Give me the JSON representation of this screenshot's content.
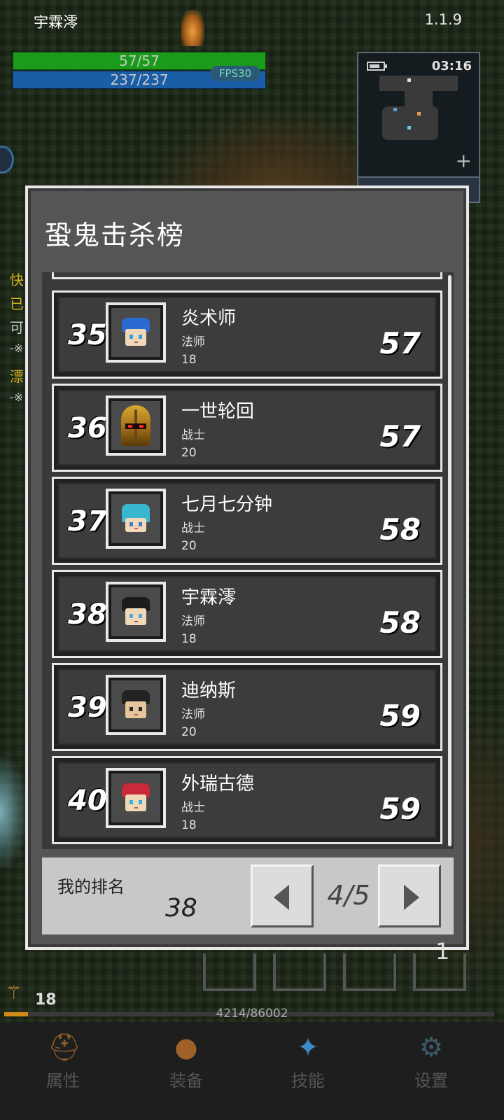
{
  "hud": {
    "player_name": "宇霖澪",
    "version": "1.1.9",
    "hp_text": "57/57",
    "mp_text": "237/237",
    "fps": "FPS30",
    "clock": "03:16",
    "side_lines": [
      "快",
      "已",
      "可",
      "-※",
      "漂",
      "-※"
    ]
  },
  "dialog": {
    "title": "蛩鬼击杀榜",
    "rows": [
      {
        "rank": "35",
        "name": "炎术师",
        "class": "法师",
        "level": "18",
        "kills": "57",
        "avatar": "blue-hair-mage-icon"
      },
      {
        "rank": "36",
        "name": "一世轮回",
        "class": "战士",
        "level": "20",
        "kills": "57",
        "avatar": "gold-helmet-warrior-icon"
      },
      {
        "rank": "37",
        "name": "七月七分钟",
        "class": "战士",
        "level": "20",
        "kills": "58",
        "avatar": "cyan-hair-warrior-icon"
      },
      {
        "rank": "38",
        "name": "宇霖澪",
        "class": "法师",
        "level": "18",
        "kills": "58",
        "avatar": "black-hair-mage-icon"
      },
      {
        "rank": "39",
        "name": "迪纳斯",
        "class": "法师",
        "level": "20",
        "kills": "59",
        "avatar": "black-hair-mage-icon"
      },
      {
        "rank": "40",
        "name": "外瑞古德",
        "class": "战士",
        "level": "18",
        "kills": "59",
        "avatar": "red-hair-warrior-icon"
      }
    ],
    "my_rank_label": "我的排名",
    "my_rank_value": "38",
    "page_indicator": "4/5"
  },
  "bottom": {
    "slot_number": "1",
    "level": "18",
    "xp_text": "4214/86002",
    "xp_fraction": 0.049,
    "nav": [
      {
        "label": "属性",
        "icon": "helmet-icon"
      },
      {
        "label": "装备",
        "icon": "bag-icon"
      },
      {
        "label": "技能",
        "icon": "crystal-icon"
      },
      {
        "label": "设置",
        "icon": "gear-icon"
      }
    ]
  },
  "colors": {
    "hp": "#1a9b1a",
    "mp": "#1a5ea8",
    "dialog_bg": "#555555",
    "rank_panel": "#c8c8c8",
    "xp": "#d48a18"
  }
}
